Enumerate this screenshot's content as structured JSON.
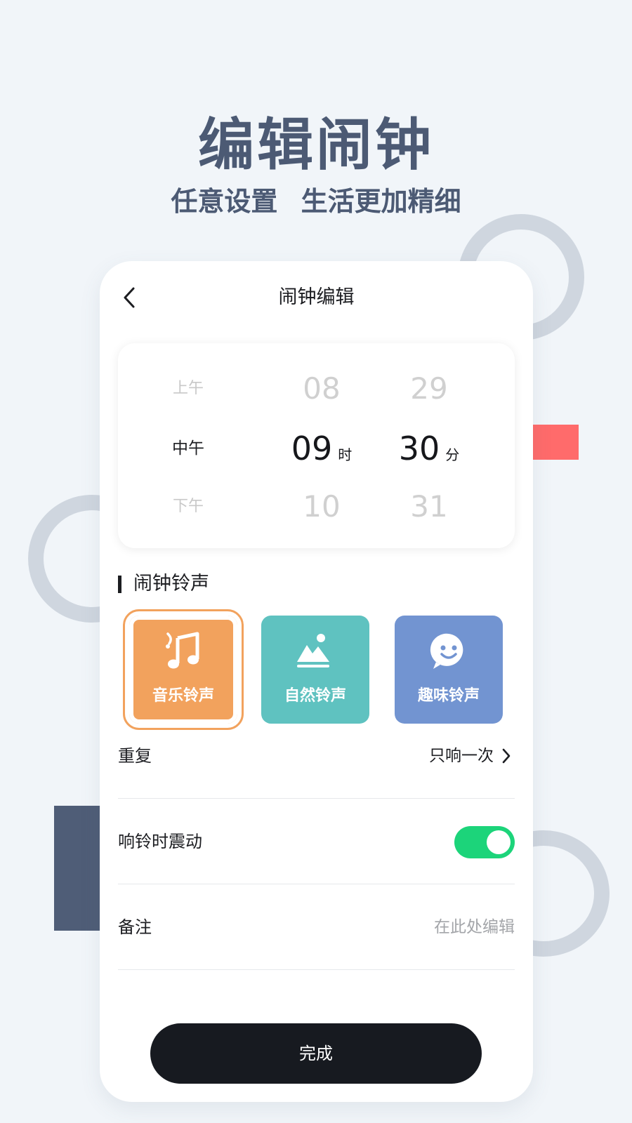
{
  "promo": {
    "headline": "编辑闹钟",
    "subheadline": "任意设置 生活更加精细"
  },
  "screen": {
    "title": "闹钟编辑",
    "picker": {
      "period": {
        "prev": "上午",
        "selected": "中午",
        "next": "下午"
      },
      "hour": {
        "prev": "08",
        "selected": "09",
        "next": "10",
        "unit": "时"
      },
      "minute": {
        "prev": "29",
        "selected": "30",
        "next": "31",
        "unit": "分"
      }
    },
    "ringtone_section": "闹钟铃声",
    "ringtones": [
      {
        "label": "音乐铃声",
        "icon": "music-note-icon",
        "color": "#f2a25d",
        "selected": true
      },
      {
        "label": "自然铃声",
        "icon": "mountain-icon",
        "color": "#5fc2c0",
        "selected": false
      },
      {
        "label": "趣味铃声",
        "icon": "smiley-icon",
        "color": "#7294d1",
        "selected": false
      }
    ],
    "settings": {
      "repeat": {
        "label": "重复",
        "value": "只响一次"
      },
      "vibrate": {
        "label": "响铃时震动",
        "on": true
      },
      "note": {
        "label": "备注",
        "placeholder": "在此处编辑"
      }
    },
    "done_label": "完成"
  },
  "colors": {
    "background": "#f1f5f9",
    "headline": "#4c5a74",
    "toggle_on": "#1cd47a",
    "accent_red": "#ff6b6b",
    "accent_navy": "#4f5d77"
  }
}
